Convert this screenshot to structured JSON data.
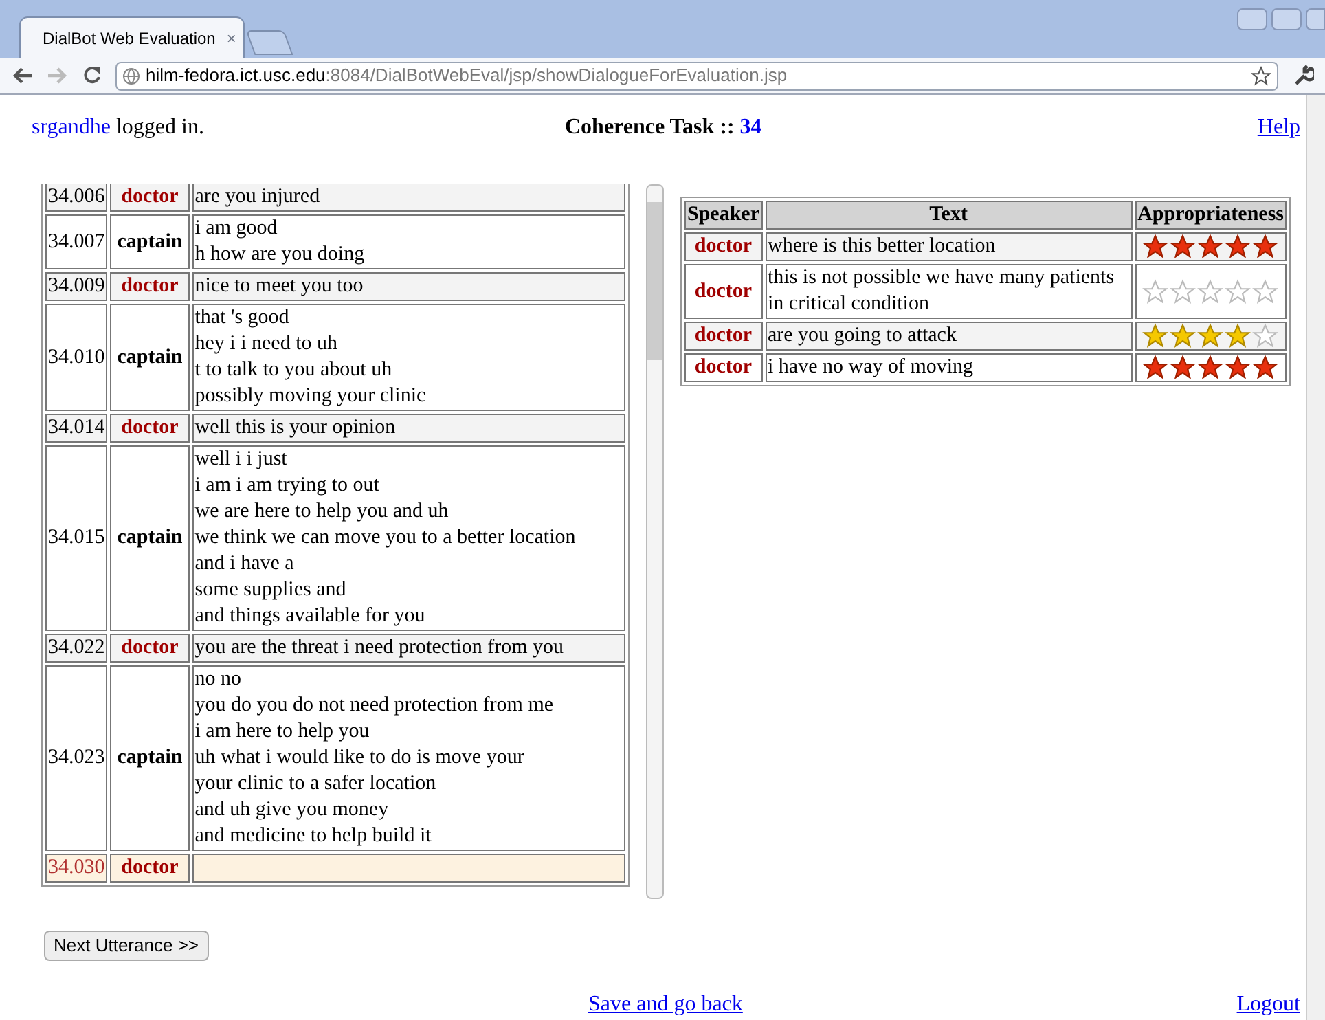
{
  "browser": {
    "tab_title": "DialBot Web Evaluation",
    "tab_close": "×",
    "url_host": "hilm-fedora.ict.usc.edu",
    "url_rest": ":8084/DialBotWebEval/jsp/showDialogueForEvaluation.jsp"
  },
  "header": {
    "user": "srgandhe",
    "user_suffix": "logged in.",
    "task_label": "Coherence Task ::",
    "task_number": "34",
    "help": "Help"
  },
  "dialogue": [
    {
      "id": "34.006",
      "speaker": "doctor",
      "kind": "doctor",
      "selected": false,
      "lines": [
        "are you injured"
      ]
    },
    {
      "id": "34.007",
      "speaker": "captain",
      "kind": "captain",
      "selected": false,
      "lines": [
        "i am good",
        "h how are you doing"
      ]
    },
    {
      "id": "34.009",
      "speaker": "doctor",
      "kind": "doctor",
      "selected": false,
      "lines": [
        "nice to meet you too"
      ]
    },
    {
      "id": "34.010",
      "speaker": "captain",
      "kind": "captain",
      "selected": false,
      "lines": [
        "that 's good",
        "hey i i need to uh",
        "t to talk to you about uh",
        "possibly moving your clinic"
      ]
    },
    {
      "id": "34.014",
      "speaker": "doctor",
      "kind": "doctor",
      "selected": false,
      "lines": [
        "well this is your opinion"
      ]
    },
    {
      "id": "34.015",
      "speaker": "captain",
      "kind": "captain",
      "selected": false,
      "lines": [
        "well i i just",
        "i am i am trying to out",
        "we are here to help you and uh",
        "we think we can move you to a better location",
        "and i have a",
        "some supplies and",
        "and things available for you"
      ]
    },
    {
      "id": "34.022",
      "speaker": "doctor",
      "kind": "doctor",
      "selected": false,
      "lines": [
        "you are the threat i need protection from you"
      ]
    },
    {
      "id": "34.023",
      "speaker": "captain",
      "kind": "captain",
      "selected": false,
      "lines": [
        "no no",
        "you do you do not need protection from me",
        "i am here to help you",
        "uh what i would like to do is move your",
        "your clinic to a safer location",
        "and uh give you money",
        "and medicine to help build it"
      ]
    },
    {
      "id": "34.030",
      "speaker": "doctor",
      "kind": "doctor",
      "selected": true
    }
  ],
  "next_button": "Next Utterance >>",
  "candidates": {
    "columns": [
      "Speaker",
      "Text",
      "Appropriateness"
    ],
    "rows": [
      {
        "speaker": "doctor",
        "text": "where is this better location",
        "stars": 5
      },
      {
        "speaker": "doctor",
        "text": "this is not possible we have many patients in critical condition",
        "stars": 0
      },
      {
        "speaker": "doctor",
        "text": "are you going to attack",
        "stars": 4
      },
      {
        "speaker": "doctor",
        "text": "i have no way of moving",
        "stars": 5
      }
    ]
  },
  "footer": {
    "save": "Save and go back",
    "logout": "Logout"
  }
}
